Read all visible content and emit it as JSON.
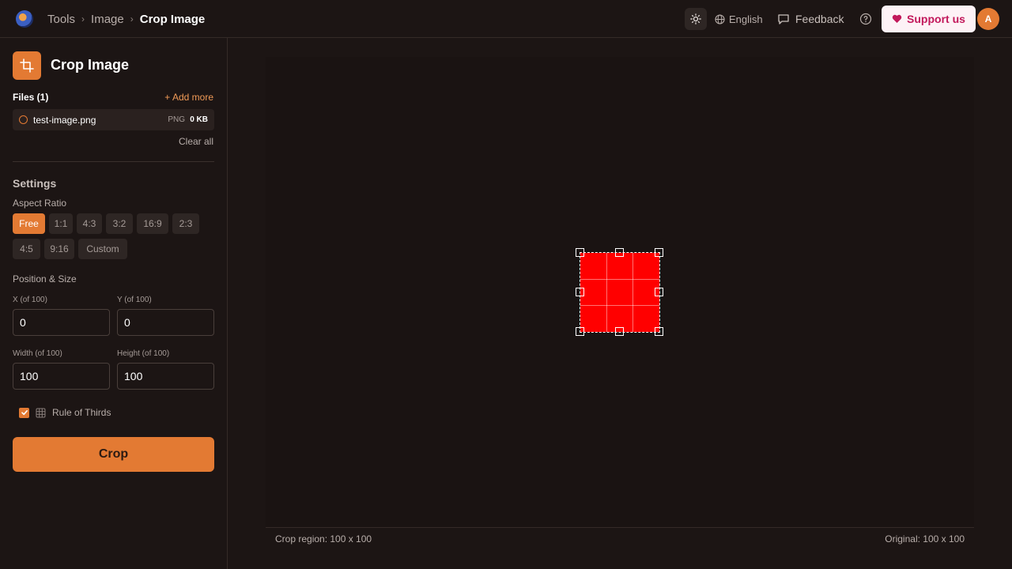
{
  "header": {
    "breadcrumbs": [
      "Tools",
      "Image",
      "Crop Image"
    ],
    "language": "English",
    "feedback": "Feedback",
    "support": "Support us",
    "avatar": "A"
  },
  "sidebar": {
    "title": "Crop Image",
    "files_label": "Files (1)",
    "add_more": "+ Add more",
    "file": {
      "name": "test-image.png",
      "type": "PNG",
      "size": "0 KB"
    },
    "clear_all": "Clear all",
    "settings_title": "Settings",
    "aspect_ratio_label": "Aspect Ratio",
    "ratios_row1": [
      "Free",
      "1:1",
      "4:3",
      "3:2",
      "16:9",
      "2:3"
    ],
    "ratios_row2": [
      "4:5",
      "9:16",
      "Custom"
    ],
    "active_ratio": "Free",
    "position_label": "Position & Size",
    "fields": {
      "x_label": "X (of 100)",
      "x_value": "0",
      "y_label": "Y (of 100)",
      "y_value": "0",
      "w_label": "Width (of 100)",
      "w_value": "100",
      "h_label": "Height (of 100)",
      "h_value": "100"
    },
    "rule_of_thirds": "Rule of Thirds",
    "rule_of_thirds_checked": true,
    "crop_button": "Crop"
  },
  "canvas": {
    "crop_region": "Crop region: 100 x 100",
    "original": "Original: 100 x 100",
    "image_color": "#ff0000"
  },
  "colors": {
    "accent": "#e37a33",
    "background": "#1c1514"
  }
}
